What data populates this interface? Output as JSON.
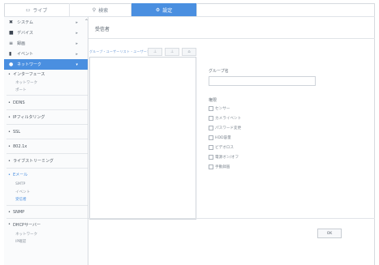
{
  "topbar": {
    "tabs": [
      {
        "label": "ライブ",
        "icon": "monitor-icon"
      },
      {
        "label": "検索",
        "icon": "search-icon"
      },
      {
        "label": "設定",
        "icon": "gear-icon"
      }
    ]
  },
  "sidebar": {
    "menu": [
      {
        "label": "システム",
        "icon": "wrench-icon"
      },
      {
        "label": "デバイス",
        "icon": "camera-icon"
      },
      {
        "label": "録画",
        "icon": "record-icon"
      },
      {
        "label": "イベント",
        "icon": "bell-icon"
      },
      {
        "label": "ネットワーク",
        "icon": "globe-icon"
      }
    ],
    "groups": [
      {
        "label": "インターフェース",
        "subs": [
          "ネットワーク",
          "ポート"
        ]
      },
      {
        "label": "DDNS",
        "subs": []
      },
      {
        "label": "IPフィルタリング",
        "subs": []
      },
      {
        "label": "SSL",
        "subs": []
      },
      {
        "label": "802.1x",
        "subs": []
      },
      {
        "label": "ライブストリーミング",
        "subs": []
      },
      {
        "label": "Eメール",
        "subs": [
          "SMTP",
          "イベント",
          "受信者"
        ]
      },
      {
        "label": "SNMP",
        "subs": []
      },
      {
        "label": "DHCPサーバー",
        "subs": [
          "ネットワーク",
          "IP確認"
        ]
      }
    ]
  },
  "main": {
    "title": "受信者",
    "list_label": "グループ・ユーザーリスト・ユーザー名",
    "list_buttons": [
      "add-icon",
      "edit-icon",
      "delete-icon"
    ],
    "group_name_label": "グループ名",
    "authority_label": "権限",
    "checkboxes": [
      "センサー",
      "カメライベント",
      "パスワード変更",
      "HDD容量",
      "ビデオロス",
      "電源オン/オフ",
      "手動録画"
    ],
    "ok_label": "OK"
  },
  "colors": {
    "accent": "#4a8fe0"
  }
}
